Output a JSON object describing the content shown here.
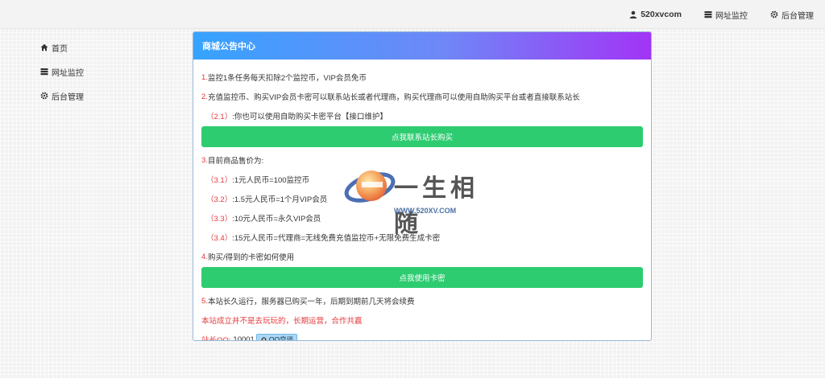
{
  "topbar": {
    "user": "520xvcom",
    "monitor": "网址监控",
    "admin": "后台管理"
  },
  "sidebar": {
    "items": [
      {
        "label": "首页",
        "icon": "home-icon"
      },
      {
        "label": "网址监控",
        "icon": "server-icon"
      },
      {
        "label": "后台管理",
        "icon": "gear-icon"
      }
    ]
  },
  "notice": {
    "title": "商城公告中心",
    "lines": [
      {
        "num": "1.",
        "text": "监控1条任务每天扣除2个监控币，VIP会员免币"
      },
      {
        "num": "2.",
        "text": "充值监控币、购买VIP会员卡密可以联系站长或者代理商，购买代理商可以使用自助购买平台或者直接联系站长"
      },
      {
        "num": "（2.1）",
        "text": ":你也可以使用自助购买卡密平台【接口维护】"
      },
      {
        "num": "3.",
        "text": "目前商品售价为:"
      },
      {
        "num": "（3.1）",
        "text": ":1元人民币=100监控币"
      },
      {
        "num": "（3.2）",
        "text": ":1.5元人民币=1个月VIP会员"
      },
      {
        "num": "（3.3）",
        "text": ":10元人民币=永久VIP会员"
      },
      {
        "num": "（3.4）",
        "text": ":15元人民币=代理商=无线免费充值监控币+无限免费生成卡密"
      },
      {
        "num": "4.",
        "text": "购买/得到的卡密如何使用"
      },
      {
        "num": "5.",
        "text": "本站长久运行，服务器已购买一年，后期到期前几天将会续费"
      }
    ],
    "btn_buy": "点我联系站长购买",
    "btn_use": "点我使用卡密",
    "alert": "本站成立并不是去玩玩的，长期运营，合作共赢",
    "qq_label": "站长QQ:",
    "qq_number": "10001",
    "qq_badge": "QQ交谈"
  },
  "watermark": {
    "text": "一生相随",
    "url": "WWW.520XV.COM"
  },
  "colors": {
    "accent_red": "#e4393c",
    "button_green": "#2ecc71",
    "header_gradient_start": "#36a3ff",
    "header_gradient_end": "#a234f6"
  }
}
